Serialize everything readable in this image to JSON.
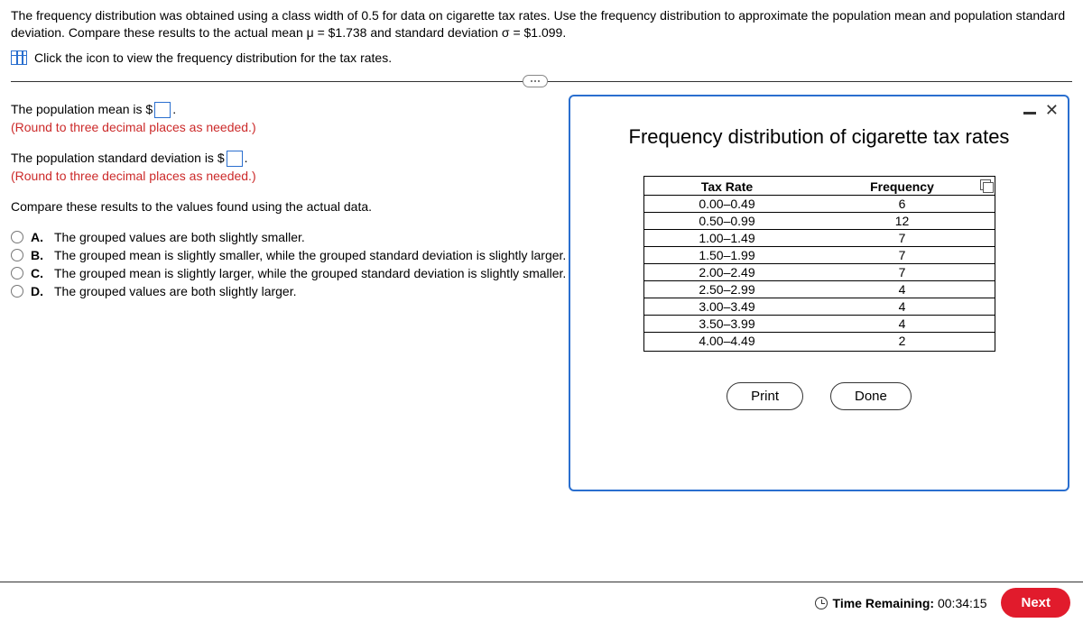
{
  "prompt": {
    "text": "The frequency distribution was obtained using a class width of 0.5 for data on cigarette tax rates. Use the frequency distribution to approximate the population mean and population standard deviation. Compare these results to the actual mean μ = $1.738 and standard deviation σ = $1.099.",
    "link": "Click the icon to view the frequency distribution for the tax rates."
  },
  "questions": {
    "mean_prefix": "The population mean is $",
    "mean_suffix": ".",
    "std_prefix": "The population standard deviation is $",
    "std_suffix": ".",
    "round_note": "(Round to three decimal places as needed.)",
    "compare": "Compare these results to the values found using the actual data."
  },
  "choices": [
    {
      "letter": "A.",
      "text": "The grouped values are both slightly smaller."
    },
    {
      "letter": "B.",
      "text": "The grouped mean is slightly smaller, while the grouped standard deviation is slightly larger."
    },
    {
      "letter": "C.",
      "text": "The grouped mean is slightly larger, while the grouped standard deviation is slightly smaller."
    },
    {
      "letter": "D.",
      "text": "The grouped values are both slightly larger."
    }
  ],
  "modal": {
    "title": "Frequency distribution of cigarette tax rates",
    "col1": "Tax Rate",
    "col2": "Frequency",
    "rows": [
      {
        "rate": "0.00–0.49",
        "freq": "6"
      },
      {
        "rate": "0.50–0.99",
        "freq": "12"
      },
      {
        "rate": "1.00–1.49",
        "freq": "7"
      },
      {
        "rate": "1.50–1.99",
        "freq": "7"
      },
      {
        "rate": "2.00–2.49",
        "freq": "7"
      },
      {
        "rate": "2.50–2.99",
        "freq": "4"
      },
      {
        "rate": "3.00–3.49",
        "freq": "4"
      },
      {
        "rate": "3.50–3.99",
        "freq": "4"
      },
      {
        "rate": "4.00–4.49",
        "freq": "2"
      }
    ],
    "print": "Print",
    "done": "Done"
  },
  "footer": {
    "time_label": "Time Remaining:",
    "time_value": "00:34:15",
    "next": "Next"
  },
  "chart_data": {
    "type": "table",
    "title": "Frequency distribution of cigarette tax rates",
    "columns": [
      "Tax Rate",
      "Frequency"
    ],
    "categories": [
      "0.00–0.49",
      "0.50–0.99",
      "1.00–1.49",
      "1.50–1.99",
      "2.00–2.49",
      "2.50–2.99",
      "3.00–3.49",
      "3.50–3.99",
      "4.00–4.49"
    ],
    "values": [
      6,
      12,
      7,
      7,
      7,
      4,
      4,
      4,
      2
    ]
  }
}
